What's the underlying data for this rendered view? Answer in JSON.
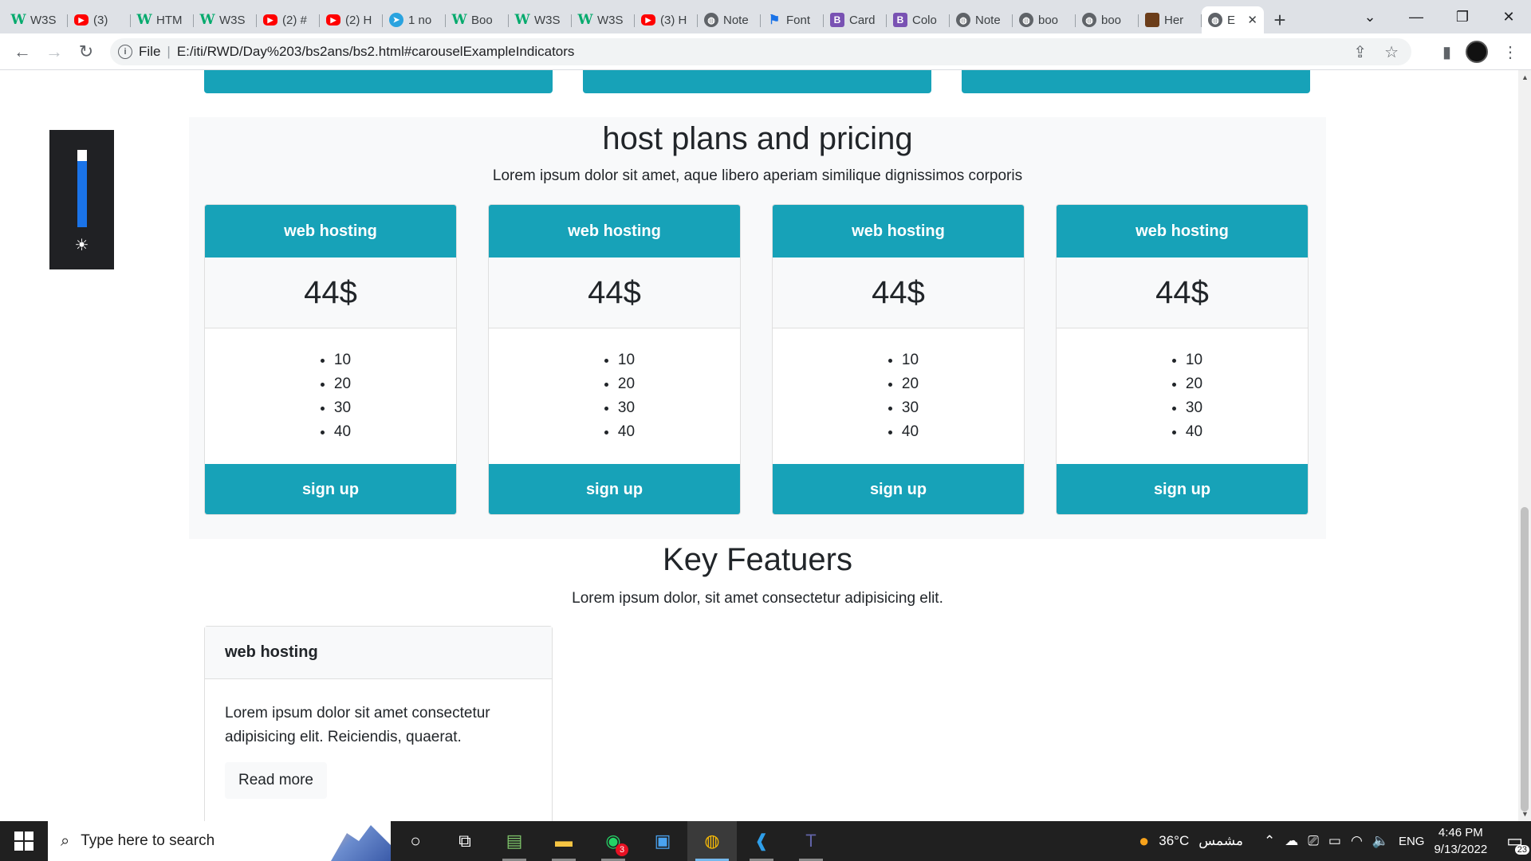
{
  "browser": {
    "tabs": [
      {
        "title": "W3S",
        "favicon": "w3schools-icon"
      },
      {
        "title": "(3)",
        "favicon": "youtube-icon"
      },
      {
        "title": "HTM",
        "favicon": "w3schools-icon"
      },
      {
        "title": "W3S",
        "favicon": "w3schools-icon"
      },
      {
        "title": "(2) #",
        "favicon": "youtube-icon"
      },
      {
        "title": "(2) H",
        "favicon": "youtube-icon"
      },
      {
        "title": "1 no",
        "favicon": "telegram-icon"
      },
      {
        "title": "Boo",
        "favicon": "w3schools-icon"
      },
      {
        "title": "W3S",
        "favicon": "w3schools-icon"
      },
      {
        "title": "W3S",
        "favicon": "w3schools-icon"
      },
      {
        "title": "(3) H",
        "favicon": "youtube-icon"
      },
      {
        "title": "Note",
        "favicon": "globe-icon"
      },
      {
        "title": "Font",
        "favicon": "flag-icon"
      },
      {
        "title": "Card",
        "favicon": "bootstrap-icon"
      },
      {
        "title": "Colo",
        "favicon": "bootstrap-icon"
      },
      {
        "title": "Note",
        "favicon": "globe-icon"
      },
      {
        "title": "boo",
        "favicon": "globe-icon"
      },
      {
        "title": "boo",
        "favicon": "globe-icon"
      },
      {
        "title": "Her",
        "favicon": "image-icon"
      },
      {
        "title": "E",
        "favicon": "globe-icon"
      }
    ],
    "new_tab": "+",
    "url_scheme": "File",
    "url": "E:/iti/RWD/Day%203/bs2ans/bs2.html#carouselExampleIndicators"
  },
  "page": {
    "pricing": {
      "title": "host plans and pricing",
      "subtitle": "Lorem ipsum dolor sit amet, aque libero aperiam similique dignissimos corporis",
      "cards": [
        {
          "header": "web hosting",
          "price": "44$",
          "items": [
            "10",
            "20",
            "30",
            "40"
          ],
          "button": "sign up"
        },
        {
          "header": "web hosting",
          "price": "44$",
          "items": [
            "10",
            "20",
            "30",
            "40"
          ],
          "button": "sign up"
        },
        {
          "header": "web hosting",
          "price": "44$",
          "items": [
            "10",
            "20",
            "30",
            "40"
          ],
          "button": "sign up"
        },
        {
          "header": "web hosting",
          "price": "44$",
          "items": [
            "10",
            "20",
            "30",
            "40"
          ],
          "button": "sign up"
        }
      ]
    },
    "features": {
      "title": "Key Featuers",
      "subtitle": "Lorem ipsum dolor, sit amet consectetur adipisicing elit.",
      "card": {
        "header": "web hosting",
        "text": "Lorem ipsum dolor sit amet consectetur adipisicing elit. Reiciendis, quaerat.",
        "button": "Read more"
      }
    }
  },
  "taskbar": {
    "search_placeholder": "Type here to search",
    "whatsapp_badge": "3",
    "weather_temp": "36°C",
    "weather_text": "مشمس",
    "language": "ENG",
    "time": "4:46 PM",
    "date": "9/13/2022",
    "notification_count": "23"
  },
  "colors": {
    "accent": "#17a2b8",
    "section_bg": "#f8f9fa",
    "brightness_widget": "#202124"
  }
}
